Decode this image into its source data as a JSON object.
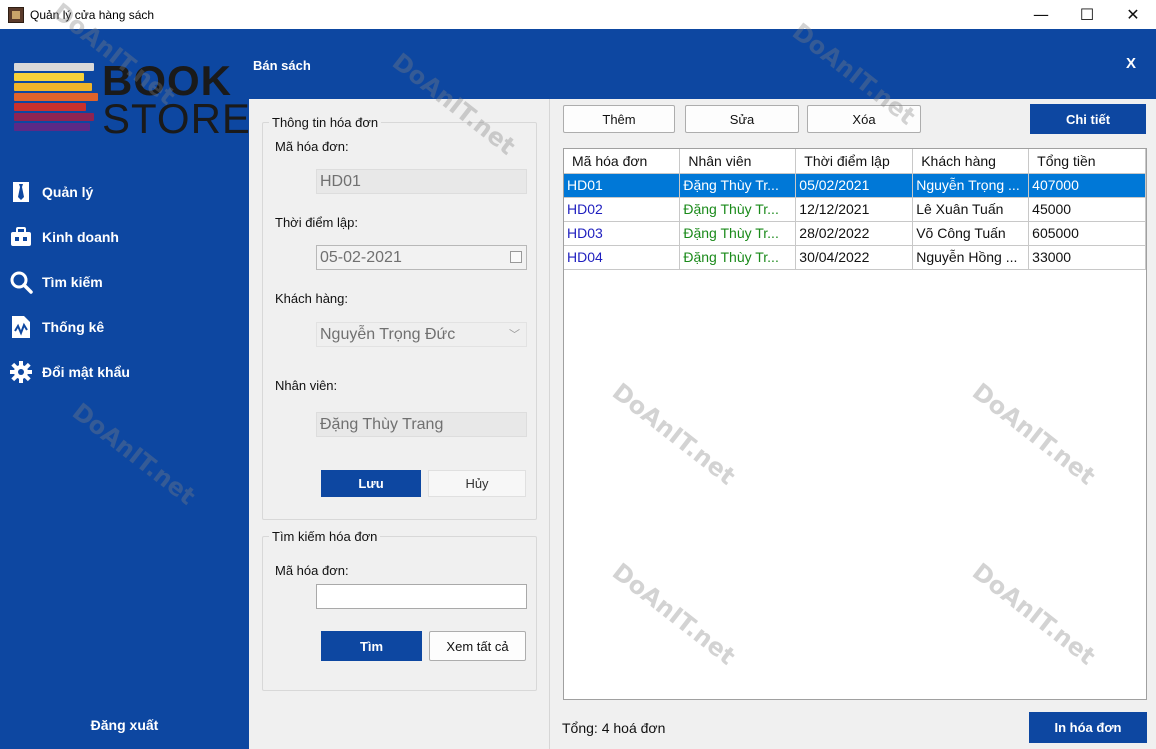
{
  "window": {
    "title": "Quản lý cửa hàng sách",
    "minimize": "—",
    "maximize": "☐",
    "close": "✕"
  },
  "sidebar": {
    "logo": {
      "line1": "BOOK",
      "line2": "STORE"
    },
    "items": [
      {
        "label": "Quản lý",
        "icon": "tie-icon"
      },
      {
        "label": "Kinh doanh",
        "icon": "briefcase-icon"
      },
      {
        "label": "Tìm kiếm",
        "icon": "search-icon"
      },
      {
        "label": "Thống kê",
        "icon": "report-chart-icon"
      },
      {
        "label": "Đổi mật khẩu",
        "icon": "gear-icon"
      }
    ],
    "logout": "Đăng xuất"
  },
  "header": {
    "title": "Bán sách",
    "close": "X"
  },
  "invoice_info": {
    "legend": "Thông tin hóa đơn",
    "id_label": "Mã hóa đơn:",
    "id_value": "HD01",
    "date_label": "Thời điểm lập:",
    "date_value": "05-02-2021",
    "customer_label": "Khách hàng:",
    "customer_value": "Nguyễn Trọng Đức",
    "employee_label": "Nhân viên:",
    "employee_value": "Đặng Thùy Trang",
    "save_label": "Lưu",
    "cancel_label": "Hủy"
  },
  "search": {
    "legend": "Tìm kiếm hóa đơn",
    "id_label": "Mã hóa đơn:",
    "input_value": "",
    "find_label": "Tìm",
    "show_all_label": "Xem tất cả"
  },
  "toolbar": {
    "add_label": "Thêm",
    "edit_label": "Sửa",
    "delete_label": "Xóa",
    "detail_label": "Chi tiết"
  },
  "table": {
    "columns": [
      "Mã hóa đơn",
      "Nhân viên",
      "Thời điểm lập",
      "Khách hàng",
      "Tổng tiền"
    ],
    "rows": [
      [
        "HD01",
        "Đặng Thùy Tr...",
        "05/02/2021",
        "Nguyễn Trọng ...",
        "407000"
      ],
      [
        "HD02",
        "Đặng Thùy Tr...",
        "12/12/2021",
        "Lê Xuân Tuấn",
        "45000"
      ],
      [
        "HD03",
        "Đặng Thùy Tr...",
        "28/02/2022",
        "Võ Công Tuấn",
        "605000"
      ],
      [
        "HD04",
        "Đặng Thùy Tr...",
        "30/04/2022",
        "Nguyễn Hồng ...",
        "33000"
      ]
    ],
    "selected_row": 0
  },
  "footer": {
    "total_text": "Tổng: 4 hoá đơn",
    "print_label": "In hóa đơn"
  },
  "watermark": {
    "brand": "DoAnIT.net"
  },
  "colors": {
    "primary": "#0d47a1",
    "selection": "#0078d7",
    "id_text": "#1f1fbf",
    "employee_text": "#1a8a1a"
  }
}
